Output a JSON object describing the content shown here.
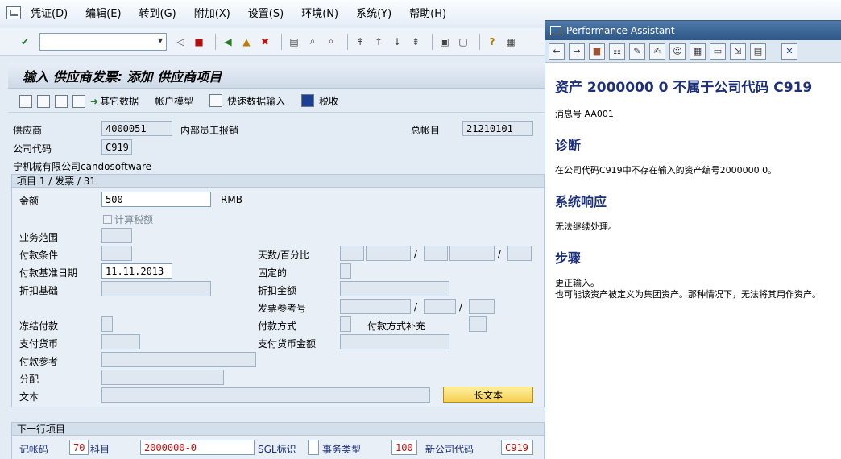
{
  "menu": [
    "凭证(D)",
    "编辑(E)",
    "转到(G)",
    "附加(X)",
    "设置(S)",
    "环境(N)",
    "系统(Y)",
    "帮助(H)"
  ],
  "screen_title": "输入 供应商发票: 添加 供应商项目",
  "app_toolbar": {
    "other_data": "其它数据",
    "account_model": "帐户模型",
    "fast_entry": "快速数据输入",
    "tax": "税收"
  },
  "header": {
    "vendor_label": "供应商",
    "vendor_value": "4000051",
    "vendor_desc": "内部员工报销",
    "gl_label": "总帐目",
    "gl_value": "21210101",
    "company_label": "公司代码",
    "company_value": "C919",
    "company_name": "宁机械有限公司candosoftware"
  },
  "item_group": {
    "title": "项目 1 / 发票 / 31",
    "amount_label": "金额",
    "amount_value": "500",
    "currency": "RMB",
    "calc_tax_label": "计算税额",
    "business_area_label": "业务范围",
    "payment_terms_label": "付款条件",
    "days_pct_label": "天数/百分比",
    "baseline_date_label": "付款基准日期",
    "baseline_date_value": "11.11.2013",
    "fixed_label": "固定的",
    "discount_base_label": "折扣基础",
    "discount_amount_label": "折扣金额",
    "invoice_ref_label": "发票参考号",
    "payment_block_label": "冻结付款",
    "payment_method_label": "付款方式",
    "payment_method_supp_label": "付款方式补充",
    "pay_currency_label": "支付货币",
    "pay_currency_amount_label": "支付货币金额",
    "payment_ref_label": "付款参考",
    "assignment_label": "分配",
    "text_label": "文本",
    "long_text_button": "长文本",
    "slash": "/"
  },
  "next_item": {
    "title": "下一行项目",
    "posting_key_label": "记帐码",
    "posting_key_value": "70",
    "account_label": "科目",
    "account_value": "2000000-0",
    "sgl_label": "SGL标识",
    "trans_type_label": "事务类型",
    "trans_type_value": "100",
    "new_company_label": "新公司代码",
    "new_company_value": "C919"
  },
  "assistant": {
    "window_title": "Performance Assistant",
    "heading": "资产  2000000 0 不属于公司代码  C919",
    "msg_no": "消息号  AA001",
    "diag_title": "诊断",
    "diag_text": "在公司代码C919中不存在输入的资产编号2000000 0。",
    "resp_title": "系统响应",
    "resp_text": "无法继续处理。",
    "steps_title": "步骤",
    "steps_text1": "更正输入。",
    "steps_text2": "也可能该资产被定义为集团资产。那种情况下，无法将其用作资产。"
  }
}
